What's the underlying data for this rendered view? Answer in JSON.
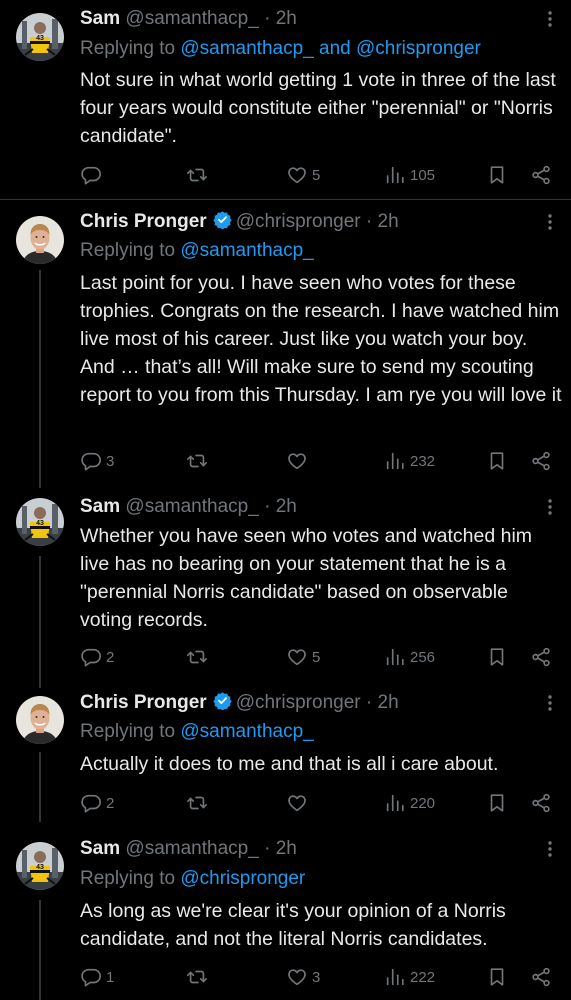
{
  "tweets": [
    {
      "author": "Sam",
      "handle": "@samanthacp_",
      "dot": "·",
      "time": "2h",
      "replying_prefix": "Replying to ",
      "replying_mentions": [
        "@samanthacp_",
        "@chrispronger"
      ],
      "replying_joiner": " and ",
      "text": "Not sure in what world getting 1 vote in three of the last four years would constitute either \"perennial\" or \"Norris candidate\".",
      "replies": "",
      "retweets": "",
      "likes": "5",
      "views": "105"
    },
    {
      "author": "Chris Pronger",
      "handle": "@chrispronger",
      "dot": "·",
      "time": "2h",
      "replying_prefix": "Replying to ",
      "replying_mentions": [
        "@samanthacp_"
      ],
      "text": "Last point for you. I have seen who votes for these trophies. Congrats on the research. I have watched him live most of his career. Just like you watch your boy. And … that’s all! Will make sure to send my scouting report to you from this Thursday. I am rye you will love it",
      "replies": "3",
      "retweets": "",
      "likes": "",
      "views": "232"
    },
    {
      "author": "Sam",
      "handle": "@samanthacp_",
      "dot": "·",
      "time": "2h",
      "text": "Whether you have seen who votes and watched him live has no bearing on your statement that he is a \"perennial Norris candidate\" based on observable voting records.",
      "replies": "2",
      "retweets": "",
      "likes": "5",
      "views": "256"
    },
    {
      "author": "Chris Pronger",
      "handle": "@chrispronger",
      "dot": "·",
      "time": "2h",
      "replying_prefix": "Replying to ",
      "replying_mentions": [
        "@samanthacp_"
      ],
      "text": "Actually it does to me and that is all i care about.",
      "replies": "2",
      "retweets": "",
      "likes": "",
      "views": "220"
    },
    {
      "author": "Sam",
      "handle": "@samanthacp_",
      "dot": "·",
      "time": "2h",
      "replying_prefix": "Replying to ",
      "replying_mentions": [
        "@chrispronger"
      ],
      "text": "As long as we're clear it's your opinion of a Norris candidate, and not the literal Norris candidates.",
      "replies": "1",
      "retweets": "",
      "likes": "3",
      "views": "222"
    }
  ],
  "colors": {
    "background": "#000000",
    "text": "#e7e9ea",
    "secondary": "#71767b",
    "link": "#1d9bf0",
    "verified": "#1d9bf0",
    "divider": "#2f3336"
  },
  "icons": [
    "reply-icon",
    "retweet-icon",
    "like-icon",
    "views-icon",
    "bookmark-icon",
    "share-icon",
    "more-icon",
    "verified-badge-icon"
  ]
}
